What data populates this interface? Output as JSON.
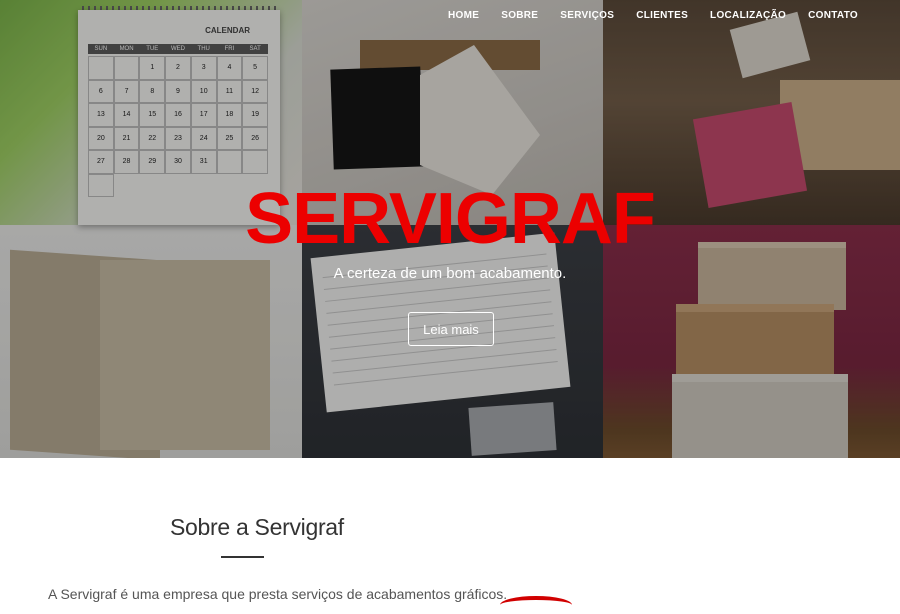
{
  "nav": {
    "items": [
      "HOME",
      "SOBRE",
      "SERVIÇOS",
      "CLIENTES",
      "LOCALIZAÇÃO",
      "CONTATO"
    ]
  },
  "hero": {
    "title": "SERVIGRAF",
    "subtitle": "A certeza de um bom acabamento.",
    "button_label": "Leia mais",
    "title_color": "#ec0000"
  },
  "calendar": {
    "title": "CALENDAR",
    "weekdays": [
      "SUN",
      "MON",
      "TUE",
      "WED",
      "THU",
      "FRI",
      "SAT"
    ],
    "days": [
      "",
      "",
      "1",
      "2",
      "3",
      "4",
      "5",
      "6",
      "7",
      "8",
      "9",
      "10",
      "11",
      "12",
      "13",
      "14",
      "15",
      "16",
      "17",
      "18",
      "19",
      "20",
      "21",
      "22",
      "23",
      "24",
      "25",
      "26",
      "27",
      "28",
      "29",
      "30",
      "31",
      "",
      "",
      ""
    ]
  },
  "about": {
    "title": "Sobre a Servigraf",
    "text": "A Servigraf é uma empresa que presta serviços de acabamentos gráficos."
  },
  "accent_color": "#d10000"
}
